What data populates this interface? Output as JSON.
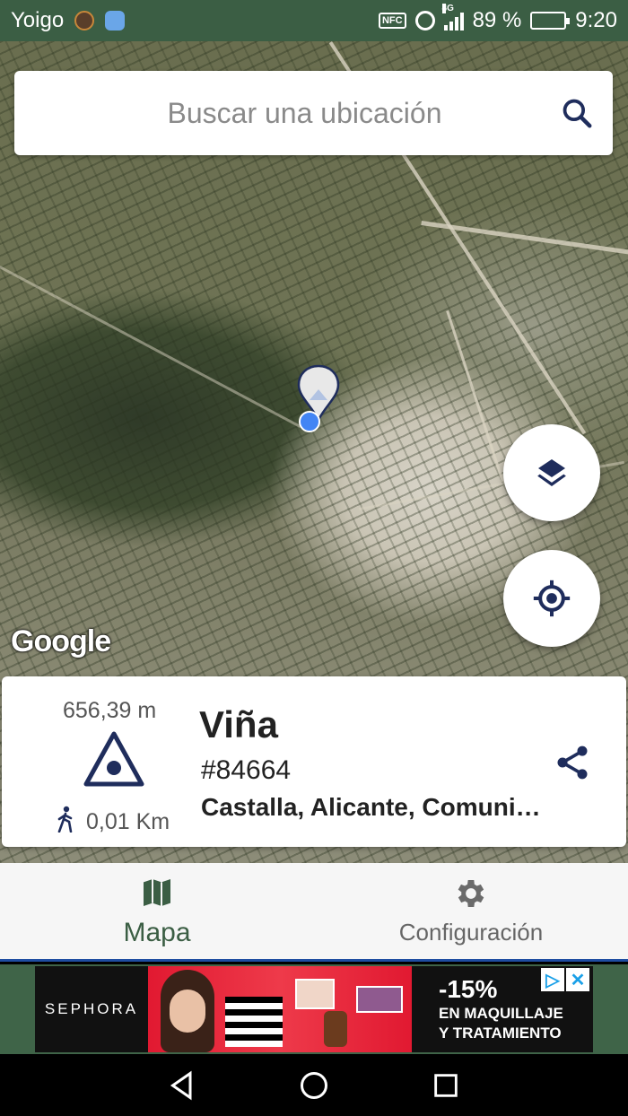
{
  "status_bar": {
    "carrier": "Yoigo",
    "nfc": "NFC",
    "network": "4G",
    "battery": "89 %",
    "battery_level": 0.89,
    "time": "9:20"
  },
  "search": {
    "placeholder": "Buscar una ubicación"
  },
  "map": {
    "attribution": "Google"
  },
  "place": {
    "elevation": "656,39 m",
    "distance": "0,01 Km",
    "name": "Viña",
    "id": "#84664",
    "address": "Castalla, Alicante, Comunidad Valenciana"
  },
  "bottom_nav": {
    "tabs": [
      {
        "label": "Mapa",
        "active": true
      },
      {
        "label": "Configuración",
        "active": false
      }
    ]
  },
  "ad": {
    "brand": "SEPHORA",
    "discount": "-15%",
    "line1": "EN MAQUILLAJE",
    "line2": "Y TRATAMIENTO"
  },
  "colors": {
    "primary": "#3b5e44",
    "navy": "#1f2d5c",
    "location_blue": "#4285f4"
  }
}
